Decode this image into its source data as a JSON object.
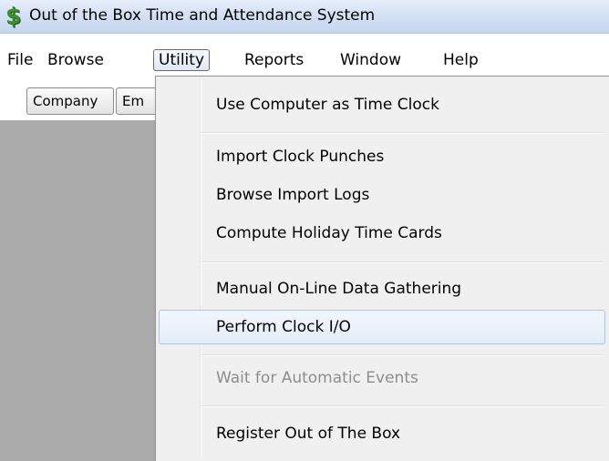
{
  "window": {
    "icon_glyph": "$",
    "icon_name": "dollar-sign-icon",
    "title": "Out of the Box Time and Attendance System"
  },
  "menubar": {
    "items": [
      {
        "label": "File"
      },
      {
        "label": "Browse"
      },
      {
        "label": "Utility",
        "active": true
      },
      {
        "label": "Reports"
      },
      {
        "label": "Window"
      },
      {
        "label": "Help"
      }
    ]
  },
  "toolbar": {
    "buttons": [
      {
        "label": "Company"
      },
      {
        "label": "Em"
      }
    ]
  },
  "utility_menu": {
    "items": [
      {
        "label": "Use Computer as Time Clock",
        "enabled": true
      },
      {
        "label": "Import Clock Punches",
        "enabled": true
      },
      {
        "label": "Browse Import Logs",
        "enabled": true
      },
      {
        "label": "Compute Holiday Time Cards",
        "enabled": true
      },
      {
        "label": "Manual On-Line Data Gathering",
        "enabled": true
      },
      {
        "label": "Perform Clock I/O",
        "enabled": true,
        "highlighted": true
      },
      {
        "label": "Wait for Automatic Events",
        "enabled": false
      },
      {
        "label": "Register Out of The Box",
        "enabled": true
      }
    ]
  },
  "colors": {
    "workspace": "#ababab",
    "titlebar": "#d4e1f4",
    "menu_background": "#f0f0f0",
    "highlight_border": "#a8c5ea",
    "disabled_text": "#8d8d8d",
    "icon_green": "#3e8e32"
  }
}
